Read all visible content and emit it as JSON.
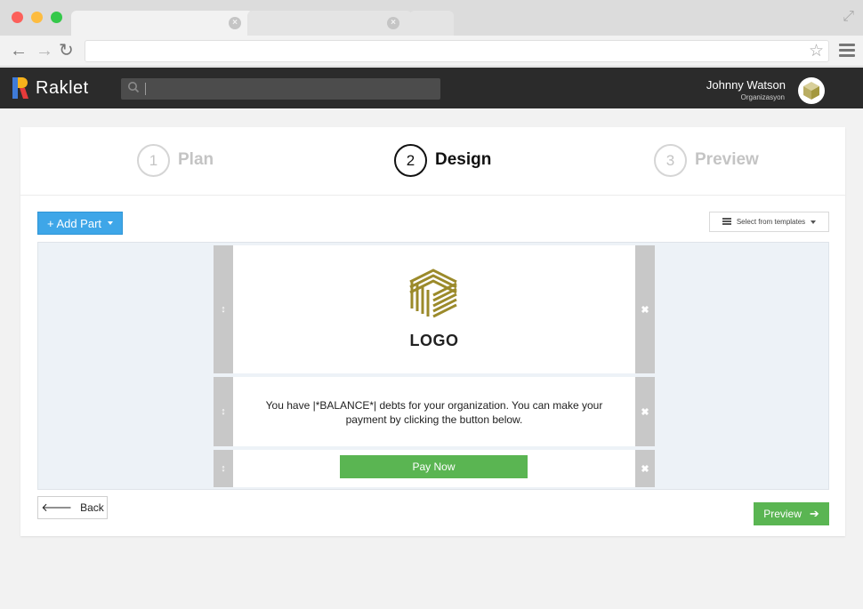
{
  "browser": {
    "tab_close_glyph": "×",
    "back_glyph": "←",
    "forward_glyph": "→",
    "reload_glyph": "↻",
    "star_glyph": "☆",
    "expand_glyph": "⤢"
  },
  "header": {
    "brand_name": "Raklet",
    "brand_colors": [
      "#f7b21b",
      "#3f7bd8",
      "#e53b3b"
    ],
    "user_name": "Johnny Watson",
    "user_org": "Organizasyon"
  },
  "steps": [
    {
      "number": "1",
      "label": "Plan",
      "active": false
    },
    {
      "number": "2",
      "label": "Design",
      "active": true
    },
    {
      "number": "3",
      "label": "Preview",
      "active": false
    }
  ],
  "toolbar": {
    "add_part_label": "+ Add Part",
    "templates_label": "Select from templates"
  },
  "parts": {
    "handle_glyph": "↕",
    "remove_glyph": "✖",
    "logo_text": "LOGO",
    "logo_color": "#9b8a2a",
    "message": "You have |*BALANCE*| debts for your organization. You can make your payment by clicking the button below.",
    "pay_button_label": "Pay Now"
  },
  "footer": {
    "back_label": "Back",
    "back_glyph": "🡐",
    "preview_label": "Preview",
    "preview_glyph": "➔"
  },
  "colors": {
    "primary_blue": "#3ea6e8",
    "success_green": "#5ab552",
    "header_dark": "#2b2b2b"
  }
}
